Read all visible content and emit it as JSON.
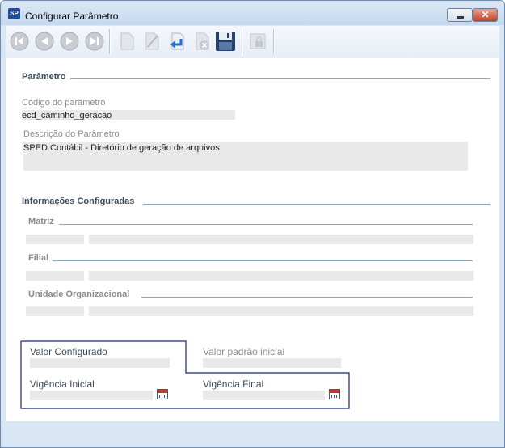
{
  "window": {
    "title": "Configurar Parâmetro",
    "app_icon": "SP",
    "close_label": "✕"
  },
  "toolbar": {
    "buttons": [
      "first-record-icon",
      "previous-record-icon",
      "next-record-icon",
      "last-record-icon",
      "new-document-icon",
      "edit-icon",
      "undo-return-icon",
      "delete-icon",
      "save-disk-icon",
      "lock-icon"
    ]
  },
  "parametro": {
    "section_title": "Parâmetro",
    "codigo_label": "Código do parâmetro",
    "codigo_value": "ecd_caminho_geracao",
    "descricao_label": "Descrição do Parâmetro",
    "descricao_value": "SPED Contábil - Diretório de geração de arquivos"
  },
  "informacoes": {
    "section_title": "Informações Configuradas",
    "matriz": "Matriz",
    "filial": "Filial",
    "unidade": "Unidade Organizacional"
  },
  "valores": {
    "valor_configurado": "Valor Configurado",
    "valor_padrao": "Valor padrão inicial",
    "vigencia_inicial": "Vigência Inicial",
    "vigencia_final": "Vigência Final"
  },
  "colors": {
    "accent_border": "#1a237e",
    "field_bg": "#e9e9e9",
    "frame_bg": "#d9e6f5"
  }
}
